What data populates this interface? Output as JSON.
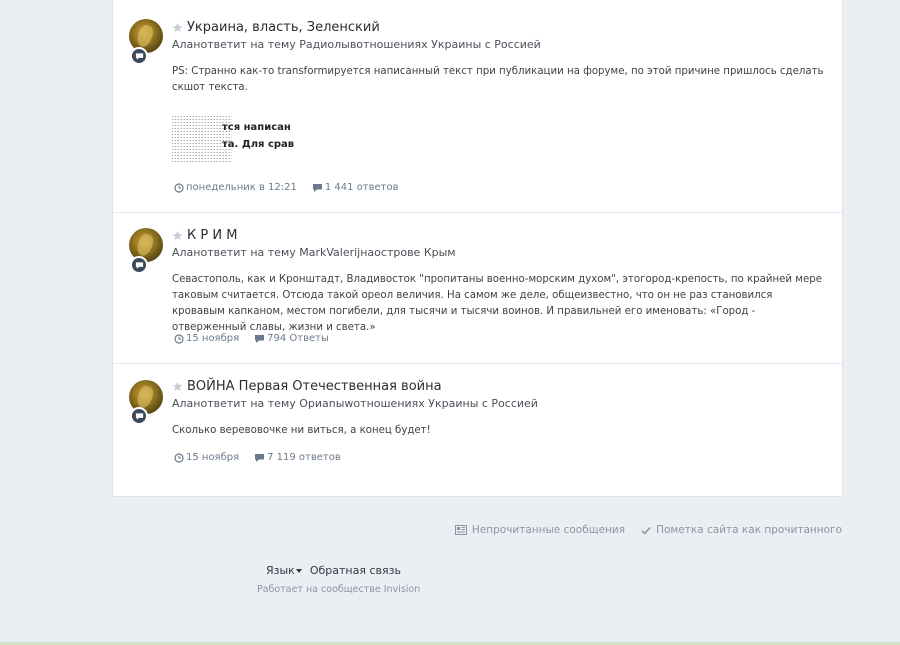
{
  "activity": [
    {
      "title": "Украина, власть, Зеленский",
      "byline": "Аланответит на тему Радиолывотношениях Украины с Россией",
      "excerpt": "PS: Странно как-то transformируется написанный текст при публикации на форуме, по этой причине пришлось сделать скшот текста.",
      "image_text_line1": "тся  написан",
      "image_text_line2": "та. Для срав",
      "time": "понедельник в 12:21",
      "replies": "1 441 ответов"
    },
    {
      "title": "К Р И М",
      "byline": "Аланответит на тему MarkValerijнаострове Крым",
      "excerpt": "Севастополь, как и Кронштадт, Владивосток \"пропитаны военно-морским духом\", этогород-крепость, по крайней мере таковым считается. Отсюда такой ореол величия. На самом же деле, общеизвестно, что он не раз становился кровавым капканом, местом погибели, для тысячи и тысячи воинов. И правильней его именовать: «Город - отверженный славы, жизни и света.»",
      "time": "15 ноября",
      "replies": "794 Ответы"
    },
    {
      "title": "ВОЙНА Первая Отечественная война",
      "byline": "Аланответит на тему Ориаnыwотношениях Украины с Россией",
      "excerpt": "Сколько веревовочке ни виться, а конец будет!",
      "time": "15 ноября",
      "replies": "7 119 ответов"
    }
  ],
  "footer": {
    "unread": "Непрочитанные сообщения",
    "mark_read": "Пометка сайта как прочитанного",
    "language": "Язык",
    "feedback": "Обратная связь",
    "powered": "Работает на сообществе Invision"
  },
  "icons": {
    "star": "star-icon",
    "comment": "comment-badge-icon",
    "clock": "clock-icon",
    "replies": "comment-icon",
    "unread": "newspaper-icon",
    "mark_read": "checkmark-icon",
    "caret": "caret-down-icon"
  },
  "colors": {
    "background": "#ebeef2",
    "card": "#ffffff",
    "meta": "#6b7a8c",
    "badge": "#3a4a5a"
  }
}
